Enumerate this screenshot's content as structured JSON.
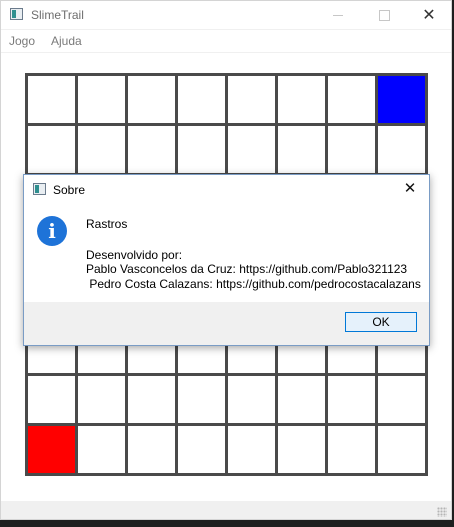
{
  "window": {
    "title": "SlimeTrail"
  },
  "menubar": {
    "items": [
      "Jogo",
      "Ajuda"
    ]
  },
  "board": {
    "rows": 8,
    "cols": 8,
    "blue_cell": {
      "row": 0,
      "col": 7
    },
    "red_cell": {
      "row": 7,
      "col": 0
    },
    "colors": {
      "blue": "#0000ff",
      "red": "#ff0000",
      "grid": "#4a4a4a"
    }
  },
  "dialog": {
    "title": "Sobre",
    "heading": "Rastros",
    "line1": "Desenvolvido por:",
    "line2": "Pablo Vasconcelos da Cruz: https://github.com/Pablo321123",
    "line3": " Pedro Costa Calazans: https://github.com/pedrocostacalazans",
    "ok_label": "OK",
    "icon": "info-icon"
  }
}
